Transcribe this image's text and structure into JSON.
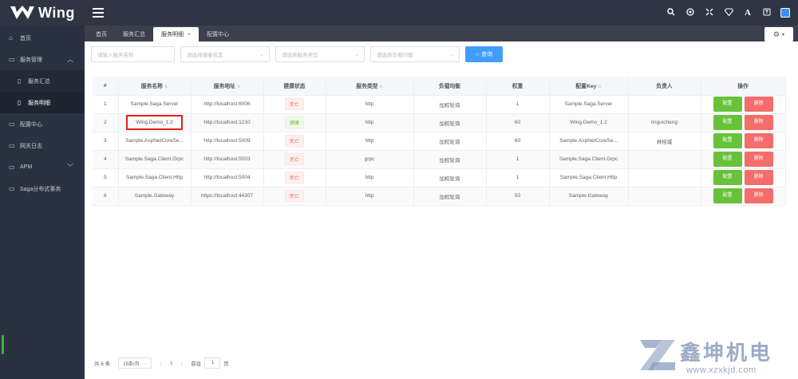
{
  "app": {
    "name": "Wing"
  },
  "topbar": {
    "icons": [
      "search-icon",
      "target-icon",
      "fullscreen-icon",
      "diamond-icon",
      "font-icon",
      "translate-icon",
      "window-icon"
    ]
  },
  "sidebar": {
    "items": [
      {
        "label": "首页",
        "icon": "home-icon"
      },
      {
        "label": "服务管理",
        "icon": "folder-icon",
        "expanded": true,
        "children": [
          {
            "label": "服务汇总",
            "icon": "doc-icon",
            "active": false
          },
          {
            "label": "服务明细",
            "icon": "doc-icon",
            "active": true
          }
        ]
      },
      {
        "label": "配置中心",
        "icon": "folder-icon"
      },
      {
        "label": "网关日志",
        "icon": "folder-icon"
      },
      {
        "label": "APM",
        "icon": "folder-icon",
        "collapsed": true
      },
      {
        "label": "Saga分布式事务",
        "icon": "folder-icon"
      }
    ]
  },
  "tabs": [
    {
      "label": "首页",
      "active": false
    },
    {
      "label": "服务汇总",
      "active": false
    },
    {
      "label": "服务明细",
      "active": true,
      "close": "×"
    },
    {
      "label": "配置中心",
      "active": false
    }
  ],
  "filters": {
    "service_name_placeholder": "请输入服务名称",
    "health_placeholder": "请选择健康状态",
    "type_placeholder": "请选择服务类型",
    "lb_placeholder": "请选择负载均衡",
    "query_label": "查询"
  },
  "table": {
    "headers": [
      "#",
      "服务名称",
      "服务地址",
      "健康状态",
      "服务类型",
      "负载均衡",
      "权重",
      "配置Key",
      "负责人",
      "操作"
    ],
    "rows": [
      {
        "no": "1",
        "name": "Sample.Saga.Server",
        "addr": "http://localhost:6006",
        "health": "死亡",
        "type": "http",
        "lb": "加权轮询",
        "weight": "1",
        "key": "Sample.Saga.Server",
        "owner": ""
      },
      {
        "no": "2",
        "name": "Wing.Demo_1.2",
        "addr": "http://localhost:1210",
        "health": "健康",
        "type": "http",
        "lb": "加权轮询",
        "weight": "60",
        "key": "Wing.Demo_1.2",
        "owner": "linguicheng"
      },
      {
        "no": "3",
        "name": "Sample.AspNetCoreSe...",
        "addr": "http://localhost:5009",
        "health": "死亡",
        "type": "http",
        "lb": "加权轮询",
        "weight": "60",
        "key": "Sample.AspNetCoreSe...",
        "owner": "林桂城"
      },
      {
        "no": "4",
        "name": "Sample.Saga.Client.Grpc",
        "addr": "http://localhost:5003",
        "health": "死亡",
        "type": "grpc",
        "lb": "加权轮询",
        "weight": "1",
        "key": "Sample.Saga.Client.Grpc",
        "owner": ""
      },
      {
        "no": "5",
        "name": "Sample.Saga.Client.Http",
        "addr": "http://localhost:5004",
        "health": "死亡",
        "type": "http",
        "lb": "加权轮询",
        "weight": "1",
        "key": "Sample.Saga.Client.Http",
        "owner": ""
      },
      {
        "no": "6",
        "name": "Sample.Gateway",
        "addr": "https://localhost:44307",
        "health": "死亡",
        "type": "http",
        "lb": "加权轮询",
        "weight": "50",
        "key": "Sample.Gateway",
        "owner": ""
      }
    ],
    "action_config": "配置",
    "action_delete": "删除"
  },
  "pagination": {
    "total": "共 6 条",
    "page_size": "15条/页",
    "prev": "‹",
    "page": "1",
    "next": "›",
    "goto_label": "前往",
    "goto_value": "1",
    "page_suffix": "页"
  },
  "watermark": {
    "title": "鑫坤机电",
    "url": "www.xzxkjd.com"
  }
}
